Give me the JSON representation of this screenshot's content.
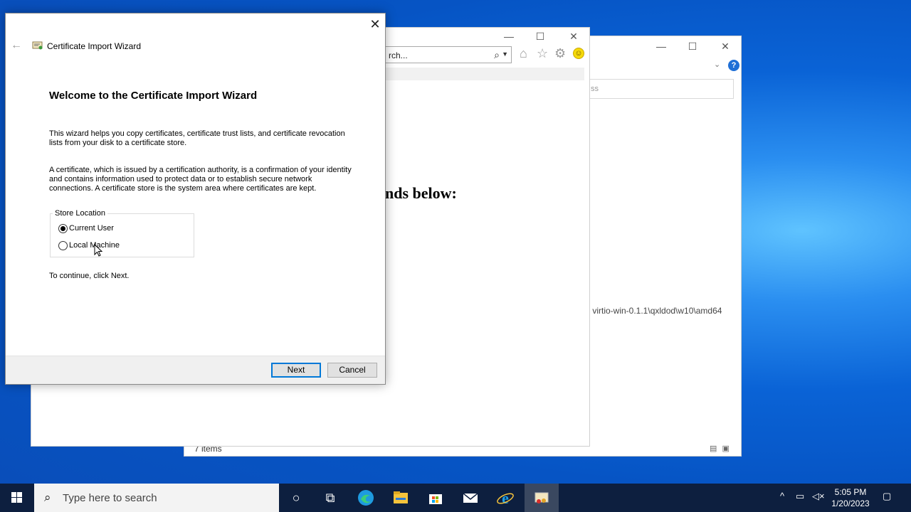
{
  "explorer": {
    "address_placeholder": "ss",
    "path_text": ") virtio-win-0.1.1\\qxldod\\w10\\amd64",
    "status": "7 items",
    "help_glyph": "?",
    "minimize_glyph": "—",
    "maximize_glyph": "☐",
    "close_glyph": "✕"
  },
  "ie": {
    "search_text": "rch...",
    "page_text": "nds below:",
    "minimize_glyph": "—",
    "maximize_glyph": "☐",
    "close_glyph": "✕"
  },
  "wizard": {
    "window_title": "Certificate Import Wizard",
    "heading": "Welcome to the Certificate Import Wizard",
    "paragraph1_line1": "This wizard helps you copy certificates, certificate trust lists, and certificate revocation",
    "paragraph1_line2": "lists from your disk to a certificate store.",
    "paragraph2_line1": "A certificate, which is issued by a certification authority, is a confirmation of your identity",
    "paragraph2_line2": "and contains information used to protect data or to establish secure network",
    "paragraph2_line3": "connections. A certificate store is the system area where certificates are kept.",
    "store_location_label": "Store Location",
    "options": [
      {
        "label": "Current User",
        "selected": true
      },
      {
        "label": "Local Machine",
        "selected": false
      }
    ],
    "continue_text": "To continue, click Next.",
    "next_label": "Next",
    "cancel_label": "Cancel",
    "close_glyph": "✕",
    "back_glyph": "←"
  },
  "taskbar": {
    "search_placeholder": "Type here to search",
    "time": "5:05 PM",
    "date": "1/20/2023"
  },
  "colors": {
    "accent": "#0078d7",
    "taskbar": "#0d1f3f",
    "desktop": "#0654c4"
  }
}
